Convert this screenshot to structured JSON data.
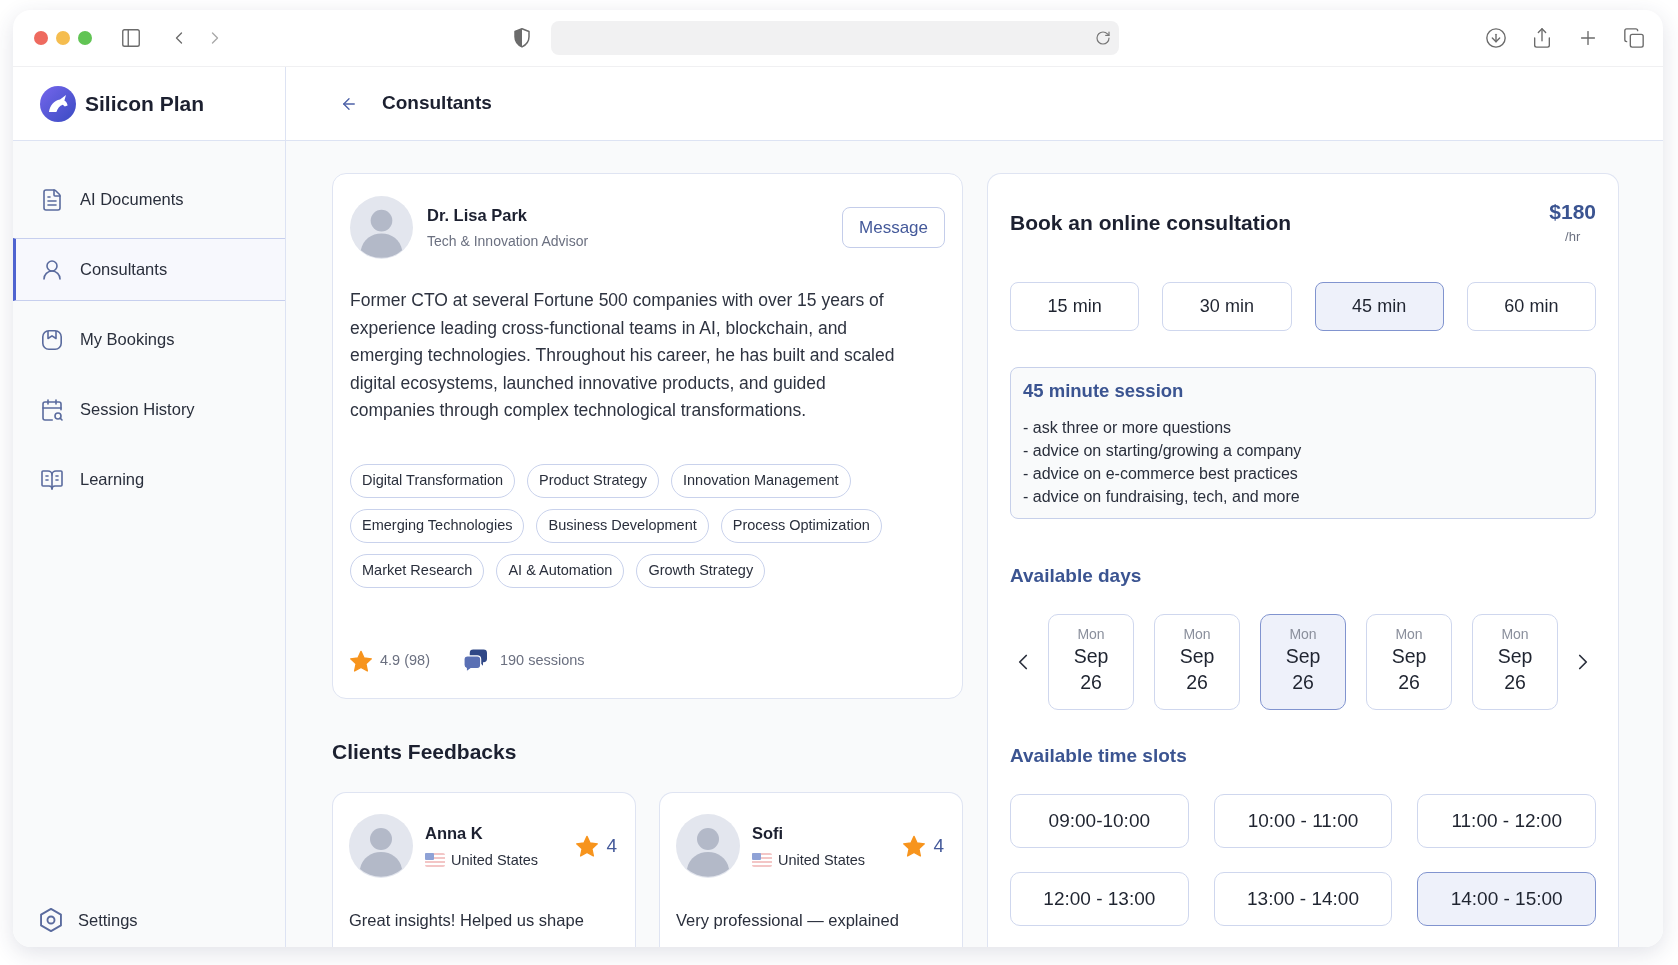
{
  "app": {
    "logo": "Silicon Plan"
  },
  "sidebar": {
    "items": [
      {
        "label": "AI Documents",
        "selected": false
      },
      {
        "label": "Consultants",
        "selected": true
      },
      {
        "label": "My Bookings",
        "selected": false
      },
      {
        "label": "Session History",
        "selected": false
      },
      {
        "label": "Learning",
        "selected": false
      }
    ],
    "footer_item": {
      "label": "Settings"
    }
  },
  "header": {
    "title": "Consultants"
  },
  "profile": {
    "name": "Dr. Lisa Park",
    "role": "Tech & Innovation Advisor",
    "message_button": "Message",
    "bio": "Former CTO at several Fortune 500 companies with over 15 years of experience leading cross-functional teams in AI, blockchain, and emerging technologies. Throughout his career, he has built and scaled digital ecosystems, launched innovative products, and guided companies through complex technological transformations.",
    "tags": [
      "Digital Transformation",
      "Product Strategy",
      "Innovation Management",
      "Emerging Technologies",
      "Business Development",
      "Process Optimization",
      "Market Research",
      "AI & Automation",
      "Growth Strategy"
    ],
    "rating": "4.9 (98)",
    "sessions": "190 sessions"
  },
  "feedbacks": {
    "title": "Clients Feedbacks",
    "items": [
      {
        "name": "Anna K",
        "country": "United States",
        "rating": "4",
        "text": "Great insights! Helped us shape"
      },
      {
        "name": "Sofi",
        "country": "United States",
        "rating": "4",
        "text": "Very professional — explained"
      }
    ]
  },
  "booking": {
    "title": "Book an online consultation",
    "price": "$180",
    "price_unit": "/hr",
    "durations": [
      {
        "label": "15 min",
        "selected": false
      },
      {
        "label": "30 min",
        "selected": false
      },
      {
        "label": "45 min",
        "selected": true
      },
      {
        "label": "60 min",
        "selected": false
      }
    ],
    "session": {
      "title": "45 minute session",
      "points": [
        "- ask three or more questions",
        "- advice on starting/growing a company",
        "- advice on e-commerce best practices",
        "- advice on fundraising, tech, and more"
      ]
    },
    "days_title": "Available days",
    "days": [
      {
        "weekday": "Mon",
        "month": "Sep",
        "day": "26",
        "selected": false
      },
      {
        "weekday": "Mon",
        "month": "Sep",
        "day": "26",
        "selected": false
      },
      {
        "weekday": "Mon",
        "month": "Sep",
        "day": "26",
        "selected": true
      },
      {
        "weekday": "Mon",
        "month": "Sep",
        "day": "26",
        "selected": false
      },
      {
        "weekday": "Mon",
        "month": "Sep",
        "day": "26",
        "selected": false
      }
    ],
    "slots_title": "Available time slots",
    "slots": [
      {
        "label": "09:00-10:00",
        "selected": false
      },
      {
        "label": "10:00 - 11:00",
        "selected": false
      },
      {
        "label": "11:00 - 12:00",
        "selected": false
      },
      {
        "label": "12:00 - 13:00",
        "selected": false
      },
      {
        "label": "13:00 - 14:00",
        "selected": false
      },
      {
        "label": "14:00 - 15:00",
        "selected": true
      }
    ]
  }
}
